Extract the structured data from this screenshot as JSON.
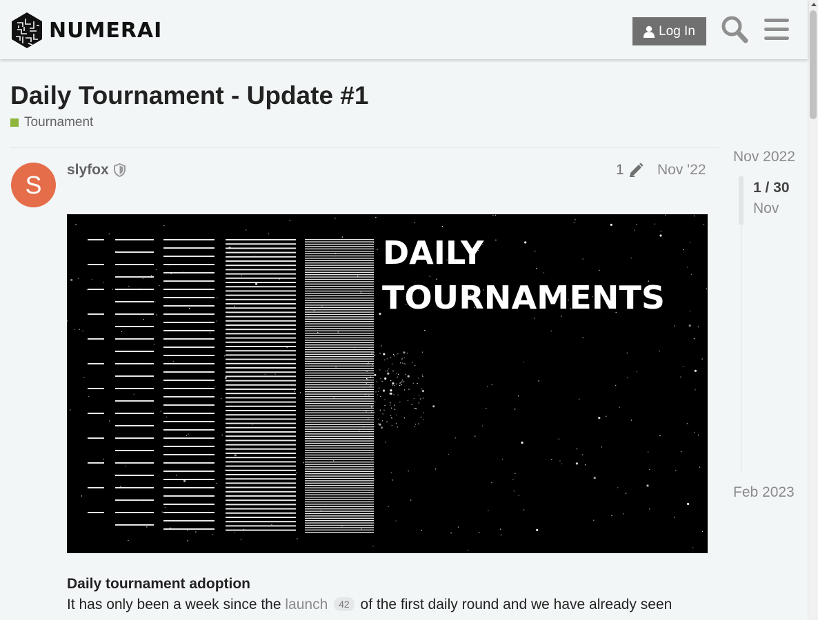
{
  "header": {
    "logo_text": "NUMERAI",
    "login_label": "Log In",
    "icons": [
      "numerai-logo-icon",
      "user-icon",
      "search-icon",
      "hamburger-menu-icon"
    ]
  },
  "topic": {
    "title": "Daily Tournament - Update #1",
    "category": "Tournament",
    "category_color": "#8eb53c"
  },
  "post": {
    "avatar_letter": "S",
    "avatar_color": "#e56d4a",
    "username": "slyfox",
    "edit_count": "1",
    "date": "Nov '22",
    "image_title": [
      "DAILY",
      "TOURNAMENTS"
    ],
    "heading": "Daily tournament adoption",
    "text_before": "It has only been a week since the ",
    "link_text": "launch",
    "link_clicks": "42",
    "text_after": " of the first daily round and we have already seen"
  },
  "timeline": {
    "start": "Nov 2022",
    "position": "1 / 30",
    "month": "Nov",
    "end": "Feb 2023"
  },
  "colors": {
    "background": "#f3f6f7",
    "login_button": "#707070"
  }
}
